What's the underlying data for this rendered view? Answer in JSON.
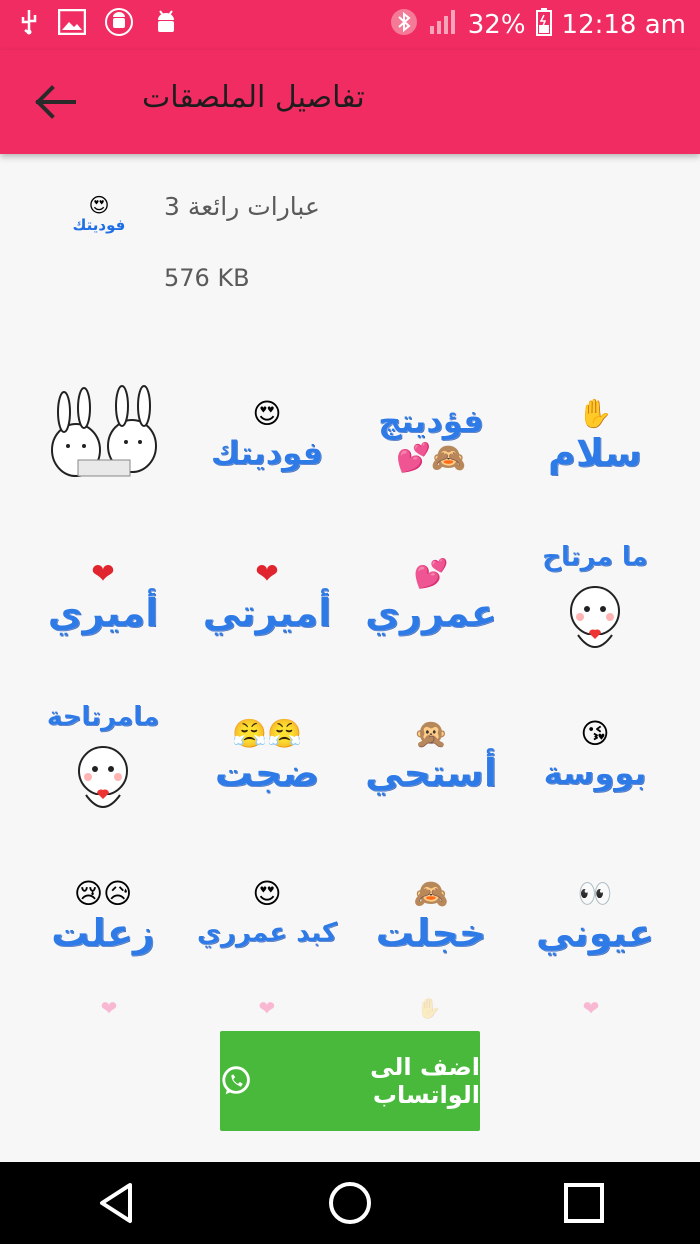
{
  "status_bar": {
    "battery": "32%",
    "time": "12:18 am",
    "left_icons": [
      "usb-icon",
      "image-icon",
      "android-debug-icon",
      "android-icon"
    ],
    "right_icons": [
      "bluetooth-icon",
      "signal-icon",
      "battery-icon"
    ]
  },
  "app_bar": {
    "title": "تفاصيل الملصقات",
    "back_icon": "arrow-left-icon",
    "color": "#f02c62"
  },
  "pack": {
    "icon_text": "فوديتك",
    "name": "عبارات رائعة 3",
    "size": "576 KB"
  },
  "stickers": [
    {
      "text": "سلام",
      "deco": "✋"
    },
    {
      "text": "فؤديتچ",
      "deco": "🙈💕"
    },
    {
      "text": "فوديتك",
      "deco": "😍"
    },
    {
      "text": "",
      "deco": "cartoon-bunnies"
    },
    {
      "text": "ما مرتاح",
      "deco": "😣"
    },
    {
      "text": "عمرري",
      "deco": "💕"
    },
    {
      "text": "أميرتي",
      "deco": "❤"
    },
    {
      "text": "أميري",
      "deco": "❤"
    },
    {
      "text": "بووسة",
      "deco": "😘"
    },
    {
      "text": "أستحي",
      "deco": "🙊"
    },
    {
      "text": "ضجت",
      "deco": "😤😤"
    },
    {
      "text": "مامرتاحة",
      "deco": "😣"
    },
    {
      "text": "عيوني",
      "deco": "👀"
    },
    {
      "text": "خجلت",
      "deco": "🙈"
    },
    {
      "text": "كبد عمرري",
      "deco": "😍"
    },
    {
      "text": "زعلت",
      "deco": "😥😢"
    }
  ],
  "action": {
    "label": "اضف الى الواتساب",
    "icon": "whatsapp-icon",
    "color": "#48b93b"
  },
  "nav": [
    "back-triangle-icon",
    "home-circle-icon",
    "recents-square-icon"
  ]
}
